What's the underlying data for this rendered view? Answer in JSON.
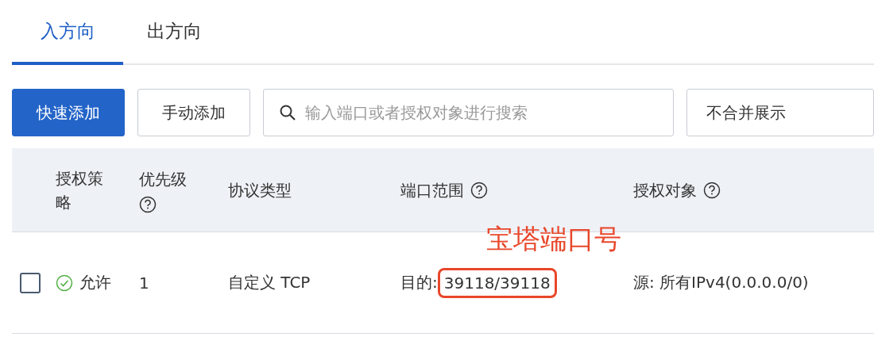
{
  "tabs": [
    {
      "label": "入方向",
      "selected": true
    },
    {
      "label": "出方向",
      "selected": false
    }
  ],
  "toolbar": {
    "buttons": [
      {
        "label": "快速添加",
        "kind": "primary"
      },
      {
        "label": "手动添加",
        "kind": "default"
      }
    ],
    "search": {
      "placeholder": "输入端口或者授权对象进行搜索"
    },
    "view_select": {
      "value": "不合并展示"
    }
  },
  "table": {
    "columns": [
      {
        "label": "授权策略",
        "help": false
      },
      {
        "label": "优先级",
        "help": true
      },
      {
        "label": "协议类型",
        "help": false
      },
      {
        "label": "端口范围",
        "help": true
      },
      {
        "label": "授权对象",
        "help": true
      }
    ],
    "rows": [
      {
        "checked": false,
        "policy": "允许",
        "priority": "1",
        "protocol": "自定义 TCP",
        "port_prefix": "目的:",
        "port": "39118/39118",
        "port_highlighted": true,
        "port_note": "宝塔端口号",
        "object": "源: 所有IPv4(0.0.0.0/0)"
      }
    ]
  }
}
